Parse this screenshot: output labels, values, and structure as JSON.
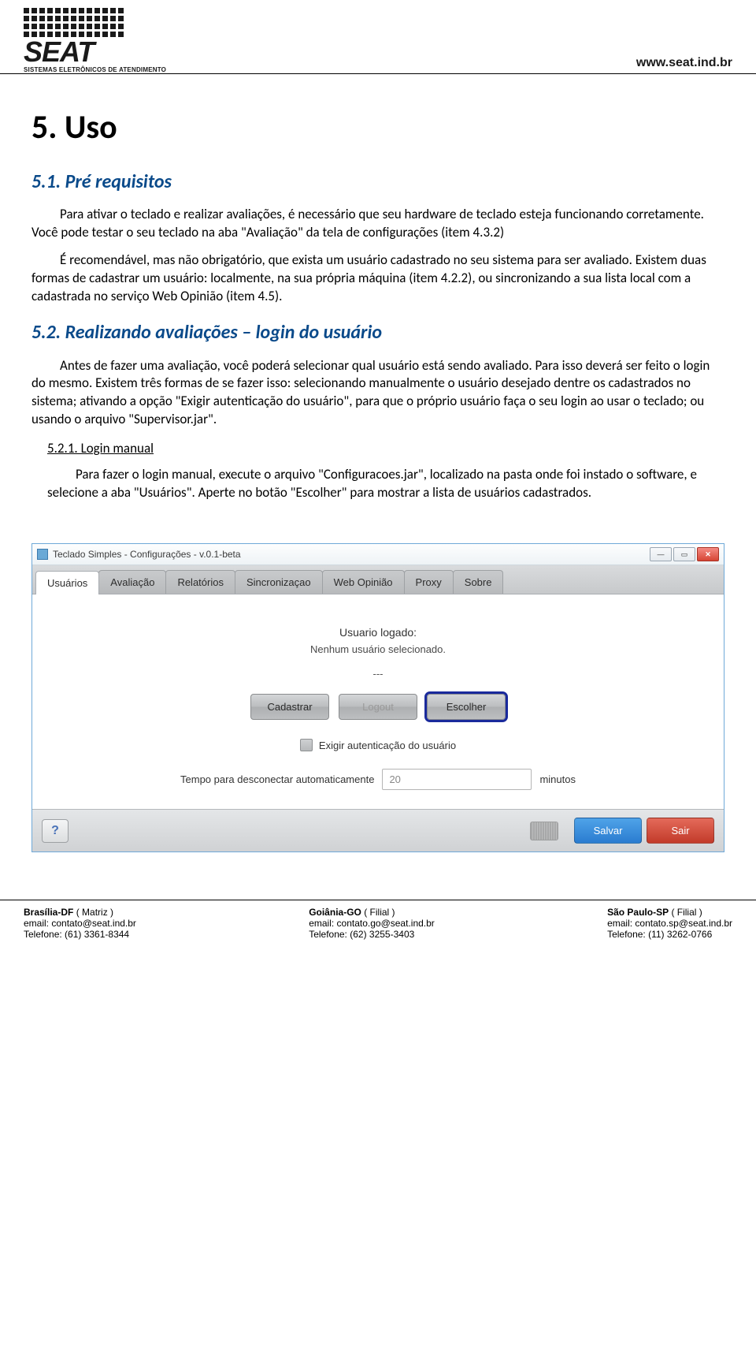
{
  "header": {
    "logo_text": "SEAT",
    "logo_sub": "SISTEMAS ELETRÔNICOS DE ATENDIMENTO",
    "site_url": "www.seat.ind.br"
  },
  "doc": {
    "h1": "5. Uso",
    "s1_title": "5.1. Pré requisitos",
    "s1_p1": "Para ativar o teclado e realizar avaliações, é necessário que seu hardware de teclado esteja funcionando corretamente. Você pode testar o seu teclado na aba \"Avaliação\" da tela de configurações (item 4.3.2)",
    "s1_p2": "É recomendável, mas não obrigatório, que exista um usuário cadastrado no seu sistema para ser avaliado. Existem duas formas de cadastrar um usuário: localmente, na sua própria máquina (item 4.2.2), ou sincronizando a sua lista local com a cadastrada no serviço Web Opinião (item 4.5).",
    "s2_title": "5.2. Realizando avaliações – login do usuário",
    "s2_p1": "Antes de fazer uma avaliação, você poderá selecionar qual usuário está sendo avaliado. Para isso deverá ser feito o login do mesmo. Existem três formas de se fazer isso: selecionando manualmente o usuário desejado dentre os cadastrados no sistema; ativando a opção \"Exigir autenticação do usuário\", para que o próprio usuário faça o seu login ao usar o teclado; ou usando o arquivo \"Supervisor.jar\".",
    "s2_1_title": "5.2.1. Login manual",
    "s2_1_p1": "Para fazer o login manual, execute o arquivo \"Configuracoes.jar\", localizado na pasta onde foi instado o software, e selecione a aba \"Usuários\". Aperte no botão \"Escolher\" para mostrar a lista de usuários cadastrados."
  },
  "app": {
    "title": "Teclado Simples - Configurações - v.0.1-beta",
    "tabs": [
      "Usuários",
      "Avaliação",
      "Relatórios",
      "Sincronizaçao",
      "Web Opinião",
      "Proxy",
      "Sobre"
    ],
    "active_tab": 0,
    "logged_label": "Usuario logado:",
    "logged_value": "Nenhum usuário selecionado.",
    "dash": "---",
    "btn_cadastrar": "Cadastrar",
    "btn_logout": "Logout",
    "btn_escolher": "Escolher",
    "chk_label": "Exigir autenticação do usuário",
    "timeout_label": "Tempo para desconectar automaticamente",
    "timeout_value": "20",
    "timeout_unit": "minutos",
    "help": "?",
    "save": "Salvar",
    "exit": "Sair"
  },
  "footer": {
    "col1": {
      "city": "Brasília-DF",
      "role": "( Matriz )",
      "email": "email: contato@seat.ind.br",
      "phone": "Telefone: (61) 3361-8344"
    },
    "col2": {
      "city": "Goiânia-GO",
      "role": "( Filial )",
      "email": "email: contato.go@seat.ind.br",
      "phone": "Telefone: (62) 3255-3403"
    },
    "col3": {
      "city": "São Paulo-SP",
      "role": "( Filial )",
      "email": "email: contato.sp@seat.ind.br",
      "phone": "Telefone: (11) 3262-0766"
    }
  }
}
